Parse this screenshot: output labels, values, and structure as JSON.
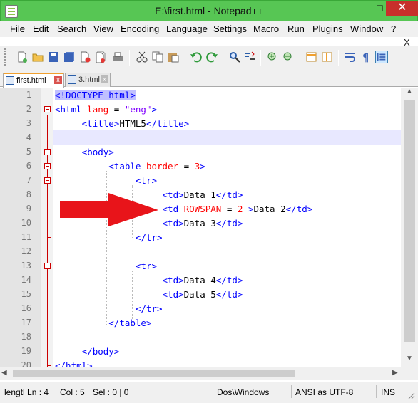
{
  "window": {
    "title": "E:\\first.html - Notepad++",
    "minimize": "–",
    "maximize": "□",
    "close": "✕"
  },
  "menu": {
    "items": [
      "File",
      "Edit",
      "Search",
      "View",
      "Encoding",
      "Language",
      "Settings",
      "Macro",
      "Run",
      "Plugins",
      "Window",
      "?"
    ],
    "close_x": "X"
  },
  "tabs": [
    {
      "label": "first.html",
      "active": true
    },
    {
      "label": "3.html",
      "active": false
    }
  ],
  "editor": {
    "lines": [
      {
        "n": "1"
      },
      {
        "n": "2"
      },
      {
        "n": "3"
      },
      {
        "n": "4"
      },
      {
        "n": "5"
      },
      {
        "n": "6"
      },
      {
        "n": "7"
      },
      {
        "n": "8"
      },
      {
        "n": "9"
      },
      {
        "n": "10"
      },
      {
        "n": "11"
      },
      {
        "n": "12"
      },
      {
        "n": "13"
      },
      {
        "n": "14"
      },
      {
        "n": "15"
      },
      {
        "n": "16"
      },
      {
        "n": "17"
      },
      {
        "n": "18"
      },
      {
        "n": "19"
      },
      {
        "n": "20"
      }
    ],
    "code": {
      "l1": "<!DOCTYPE html>",
      "l2_tag": "<html",
      "l2_attr": "lang",
      "l2_eq": " = ",
      "l2_str": "\"eng\"",
      "l2_close": ">",
      "l3_open": "<title>",
      "l3_text": "HTML5",
      "l3_close": "</title>",
      "l5": "<body>",
      "l6_tag": "<table",
      "l6_attr": "border",
      "l6_eq": " = ",
      "l6_val": "3",
      "l6_close": ">",
      "l7": "<tr>",
      "l8_open": "<td>",
      "l8_text": "Data 1",
      "l8_close": "</td>",
      "l9_tag": "<td",
      "l9_attr": "ROWSPAN",
      "l9_eq": " = ",
      "l9_val": "2",
      "l9_close": " >",
      "l9_text": "Data 2",
      "l9_end": "</td>",
      "l10_open": "<td>",
      "l10_text": "Data 3",
      "l10_close": "</td>",
      "l11": "</tr>",
      "l13": "<tr>",
      "l14_open": "<td>",
      "l14_text": "Data 4",
      "l14_close": "</td>",
      "l15_open": "<td>",
      "l15_text": "Data 5",
      "l15_close": "</td>",
      "l16": "</tr>",
      "l17": "</table>",
      "l19": "</body>",
      "l20": "</html>"
    }
  },
  "status": {
    "length_lines": "lengtl Ln : 4",
    "col": "Col : 5",
    "sel": "Sel : 0 | 0",
    "eol": "Dos\\Windows",
    "encoding": "ANSI as UTF-8",
    "mode": "INS"
  },
  "colors": {
    "titlebar": "#57c654",
    "tag": "#0000ff",
    "attribute": "#ff0000",
    "string": "#8000ff",
    "arrow": "#e8141a"
  }
}
